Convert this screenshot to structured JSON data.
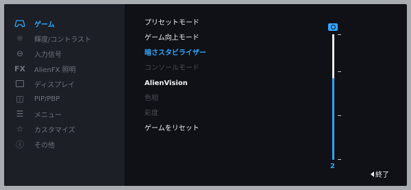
{
  "menu": [
    {
      "label": "ゲーム",
      "icon": "gamepad-icon",
      "active": true
    },
    {
      "label": "輝度/コントラスト",
      "icon": "brightness-icon"
    },
    {
      "label": "入力信号",
      "icon": "input-icon"
    },
    {
      "label": "AlienFX 照明",
      "icon": "fx-icon",
      "icon_text": "FX"
    },
    {
      "label": "ディスプレイ",
      "icon": "monitor-icon"
    },
    {
      "label": "PIP/PBP",
      "icon": "pip-icon"
    },
    {
      "label": "メニュー",
      "icon": "menu-list-icon"
    },
    {
      "label": "カスタマイズ",
      "icon": "star-icon"
    },
    {
      "label": "その他",
      "icon": "info-icon"
    }
  ],
  "submenu": [
    {
      "label": "プリセットモード",
      "state": "normal"
    },
    {
      "label": "ゲーム向上モード",
      "state": "normal"
    },
    {
      "label": "暗さスタビライザー",
      "state": "selected"
    },
    {
      "label": "コンソールモード",
      "state": "disabled"
    },
    {
      "label": "AlienVision",
      "state": "normal"
    },
    {
      "label": "色相",
      "state": "disabled"
    },
    {
      "label": "彩度",
      "state": "disabled"
    },
    {
      "label": "ゲームをリセット",
      "state": "normal"
    }
  ],
  "slider": {
    "value": "2",
    "level_fraction": 0.65
  },
  "exit_label": "終了",
  "colors": {
    "accent": "#33a6ff",
    "panel": "#1c1f26",
    "background": "#0f1116"
  }
}
